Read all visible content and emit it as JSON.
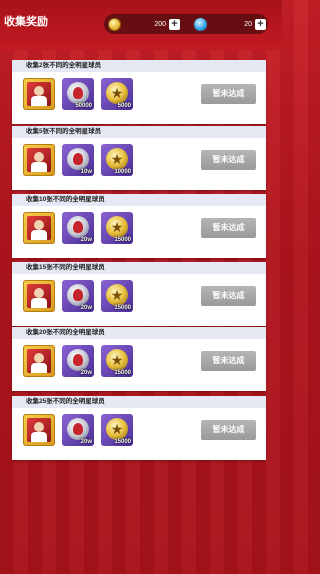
{
  "header": {
    "title": "收集奖励",
    "gold_amount": "200",
    "gem_amount": "20",
    "gold_icon": "gold-coin-icon",
    "gem_icon": "blue-gem-icon"
  },
  "rewards_list": [
    {
      "title": "收集2张不同的全明星球员",
      "status": "暂未达成",
      "items": [
        {
          "type": "player-card",
          "qty": ""
        },
        {
          "type": "silver-ball",
          "qty": "50000"
        },
        {
          "type": "gold-star",
          "qty": "5000"
        }
      ]
    },
    {
      "title": "收集5张不同的全明星球员",
      "status": "暂未达成",
      "items": [
        {
          "type": "player-card",
          "qty": ""
        },
        {
          "type": "silver-ball",
          "qty": "10w"
        },
        {
          "type": "gold-star",
          "qty": "10000"
        }
      ]
    },
    {
      "title": "收集10张不同的全明星球员",
      "status": "暂未达成",
      "items": [
        {
          "type": "player-card",
          "qty": ""
        },
        {
          "type": "silver-ball",
          "qty": "20w"
        },
        {
          "type": "gold-star",
          "qty": "15000"
        }
      ]
    },
    {
      "title": "收集15张不同的全明星球员",
      "status": "暂未达成",
      "items": [
        {
          "type": "player-card",
          "qty": ""
        },
        {
          "type": "silver-ball",
          "qty": "20w"
        },
        {
          "type": "gold-star",
          "qty": "15000"
        }
      ]
    },
    {
      "title": "收集20张不同的全明星球员",
      "status": "暂未达成",
      "items": [
        {
          "type": "player-card",
          "qty": ""
        },
        {
          "type": "silver-ball",
          "qty": "20w"
        },
        {
          "type": "gold-star",
          "qty": "15000"
        }
      ]
    },
    {
      "title": "收集25张不同的全明星球员",
      "status": "暂未达成",
      "items": [
        {
          "type": "player-card",
          "qty": ""
        },
        {
          "type": "silver-ball",
          "qty": "20w"
        },
        {
          "type": "gold-star",
          "qty": "15000"
        }
      ]
    }
  ]
}
